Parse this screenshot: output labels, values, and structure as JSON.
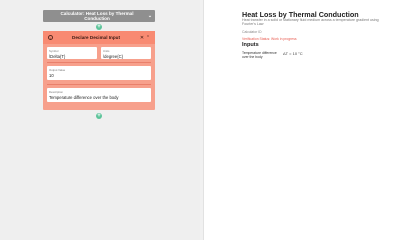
{
  "builder": {
    "calculator_title": "Calculator: Heat Loss by Thermal Conduction",
    "chevron": "⌄",
    "add_symbol": "+",
    "card": {
      "title": "Declare Decimal Input",
      "info_glyph": "i",
      "close_glyph": "✕",
      "collapse_glyph": "⌃",
      "symbol": {
        "label": "Symbol",
        "value": "\\Delta{T}"
      },
      "units": {
        "label": "Units",
        "value": "\\degree{C}"
      },
      "output_value": {
        "label": "Output Value",
        "value": "10"
      },
      "description": {
        "label": "Description",
        "value": "Temperature difference over the body"
      }
    }
  },
  "preview": {
    "title": "Heat Loss by Thermal Conduction",
    "description": "Heat transfer in a solid or stationary fluid medium across a temperature gradient using Fourier's Law",
    "calc_id": "Calculator ID",
    "status": "Verification Status: Work in progress",
    "inputs_heading": "Inputs",
    "inputs": [
      {
        "label": "Temperature difference over the body",
        "value": "ΔT = 10 °C"
      }
    ]
  },
  "colors": {
    "card_header": "#f88a72",
    "card_body": "#f7a08c",
    "calc_bar": "#8f8f8f",
    "add_node": "#5cc49a",
    "status": "#e85a4f"
  }
}
